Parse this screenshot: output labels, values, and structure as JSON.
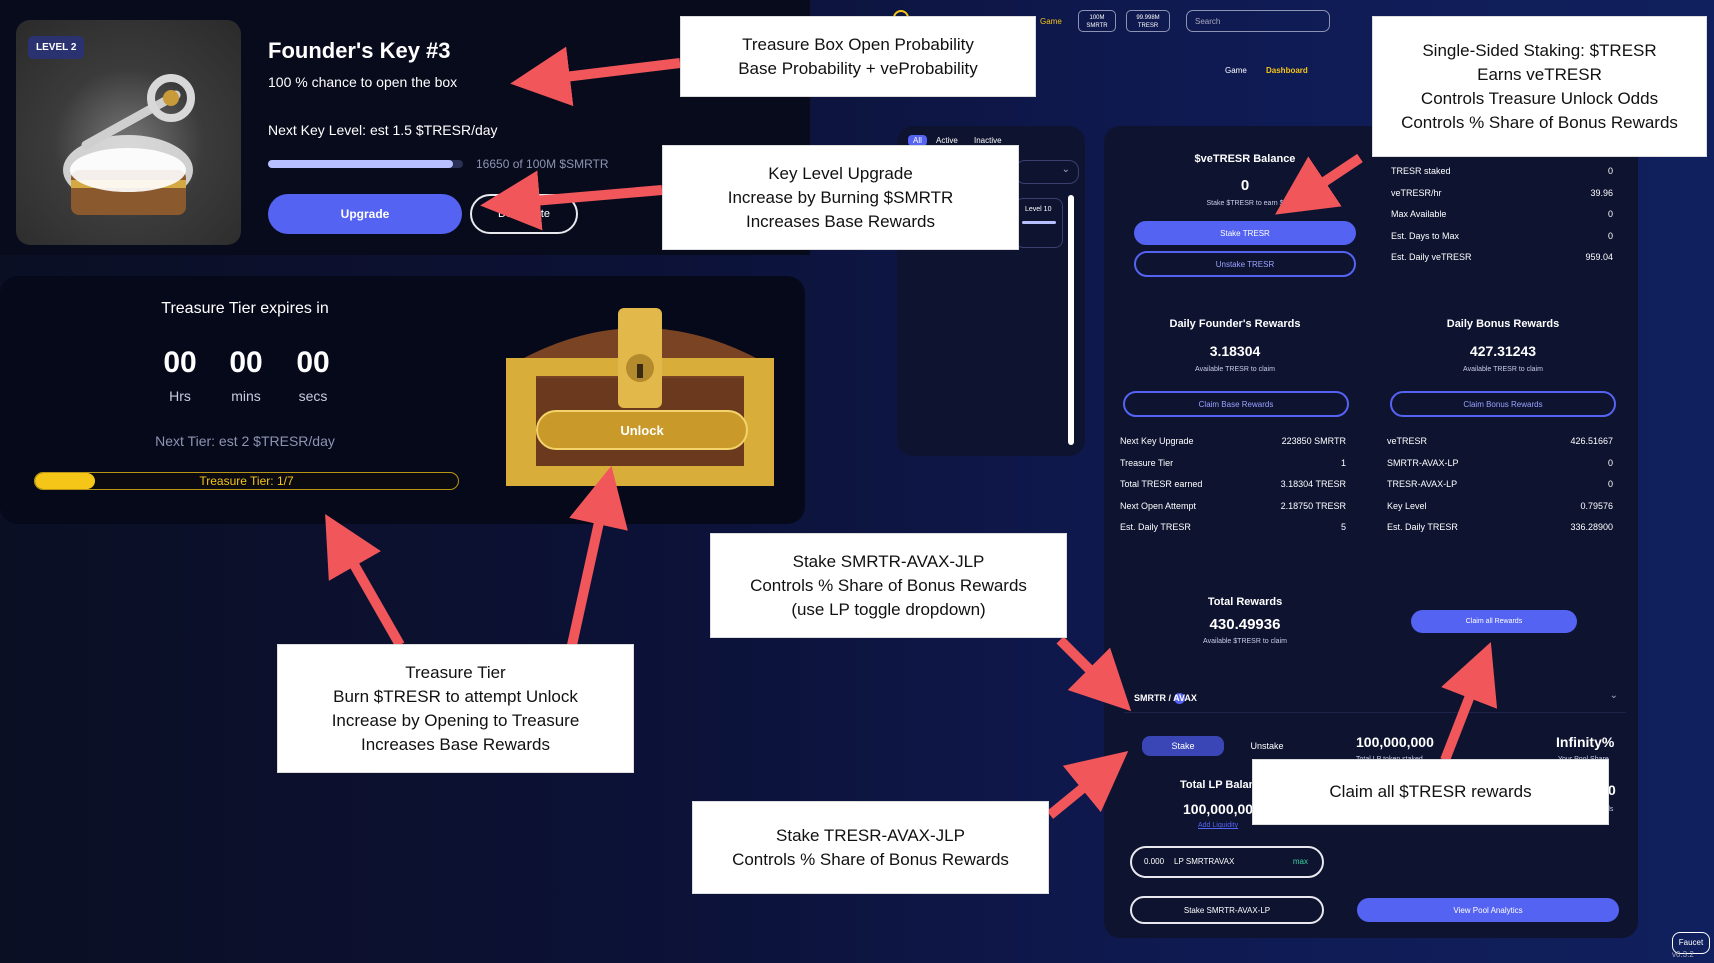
{
  "founder_key": {
    "level_badge": "LEVEL 2",
    "title": "Founder's Key #3",
    "subtitle": "100 % chance to open the box",
    "next_level": "Next Key Level: est 1.5 $TRESR/day",
    "progress_text": "16650 of 100M $SMRTR",
    "progress_fraction": 0.95,
    "upgrade_label": "Upgrade",
    "deactivate_label": "Deactivate"
  },
  "treasure": {
    "expires_label": "Treasure Tier expires in",
    "hrs_value": "00",
    "mins_value": "00",
    "secs_value": "00",
    "hrs_label": "Hrs",
    "mins_label": "mins",
    "secs_label": "secs",
    "next_tier": "Next Tier: est 2 $TRESR/day",
    "tier_text": "Treasure Tier: 1/7",
    "tier_fraction": 0.143,
    "unlock_label": "Unlock"
  },
  "topbar": {
    "game_tab": "Game",
    "badge1_top": "100M",
    "badge1_bottom": "SMRTR",
    "badge2_top": "99.998M",
    "badge2_bottom": "TRESR",
    "search_placeholder": "Search",
    "nav_game": "Game",
    "nav_dashboard": "Dashboard"
  },
  "filters": {
    "all": "All",
    "active": "Active",
    "inactive": "Inactive",
    "level_item": "Level 10"
  },
  "vetresr": {
    "title": "$veTRESR Balance",
    "value": "0",
    "note": "Stake $TRESR to earn $",
    "stake_btn": "Stake TRESR",
    "unstake_btn": "Unstake TRESR",
    "stats": [
      {
        "label": "TRESR staked",
        "value": "0"
      },
      {
        "label": "veTRESR/hr",
        "value": "39.96"
      },
      {
        "label": "Max Available",
        "value": "0"
      },
      {
        "label": "Est. Days to Max",
        "value": "0"
      },
      {
        "label": "Est. Daily veTRESR",
        "value": "959.04"
      }
    ]
  },
  "founders_rewards": {
    "title": "Daily Founder's Rewards",
    "value": "3.18304",
    "note": "Available TRESR to claim",
    "claim_btn": "Claim Base Rewards",
    "rows": [
      {
        "label": "Next Key Upgrade",
        "value": "223850 SMRTR"
      },
      {
        "label": "Treasure Tier",
        "value": "1"
      },
      {
        "label": "Total TRESR earned",
        "value": "3.18304 TRESR"
      },
      {
        "label": "Next Open Attempt",
        "value": "2.18750 TRESR"
      },
      {
        "label": "Est. Daily TRESR",
        "value": "5"
      }
    ]
  },
  "bonus_rewards": {
    "title": "Daily Bonus Rewards",
    "value": "427.31243",
    "note": "Available TRESR to claim",
    "claim_btn": "Claim Bonus Rewards",
    "rows": [
      {
        "label": "veTRESR",
        "value": "426.51667"
      },
      {
        "label": "SMRTR-AVAX-LP",
        "value": "0"
      },
      {
        "label": "TRESR-AVAX-LP",
        "value": "0"
      },
      {
        "label": "Key Level",
        "value": "0.79576"
      },
      {
        "label": "Est. Daily TRESR",
        "value": "336.28900"
      }
    ]
  },
  "total_rewards": {
    "title": "Total Rewards",
    "value": "430.49936",
    "note": "Available $TRESR to claim",
    "claim_all_btn": "Claim all Rewards"
  },
  "lp": {
    "pair": "SMRTR / AVAX",
    "stake_tab": "Stake",
    "unstake_tab": "Unstake",
    "total_label": "Total LP Balan",
    "total_value": "100,000,00",
    "add_liquidity": "Add Liquidity",
    "big_value": "100,000,000",
    "big_value_sub": "Total LP token staked",
    "infinity": "Infinity%",
    "infinity_sub": "Your Pool Share",
    "input_value": "0.000",
    "input_unit": "LP SMRTRAVAX",
    "max_label": "max",
    "stake_lp_btn": "Stake SMRTR-AVAX-LP",
    "analytics_btn": "View Pool Analytics",
    "right_zero": "0",
    "right_ds": "ds"
  },
  "faucet": "Faucet",
  "version": "v0.3.2",
  "annotations": {
    "a1": [
      "Treasure Box Open Probability",
      "Base Probability + veProbability"
    ],
    "a2": [
      "Single-Sided Staking: $TRESR",
      "Earns veTRESR",
      "Controls Treasure Unlock Odds",
      "Controls % Share of Bonus Rewards"
    ],
    "a3": [
      "Key Level Upgrade",
      "Increase by Burning $SMRTR",
      "Increases Base Rewards"
    ],
    "a4": [
      "Stake SMRTR-AVAX-JLP",
      "Controls % Share of Bonus Rewards",
      "(use LP toggle dropdown)"
    ],
    "a5": [
      "Treasure Tier",
      "Burn $TRESR to attempt Unlock",
      "Increase by Opening to Treasure",
      "Increases Base Rewards"
    ],
    "a6": [
      "Claim all $TRESR rewards"
    ],
    "a7": [
      "Stake TRESR-AVAX-JLP",
      "Controls % Share of Bonus Rewards"
    ]
  },
  "colors": {
    "accent": "#5563f2",
    "gold": "#f5c518",
    "arrow": "#f0565a"
  }
}
